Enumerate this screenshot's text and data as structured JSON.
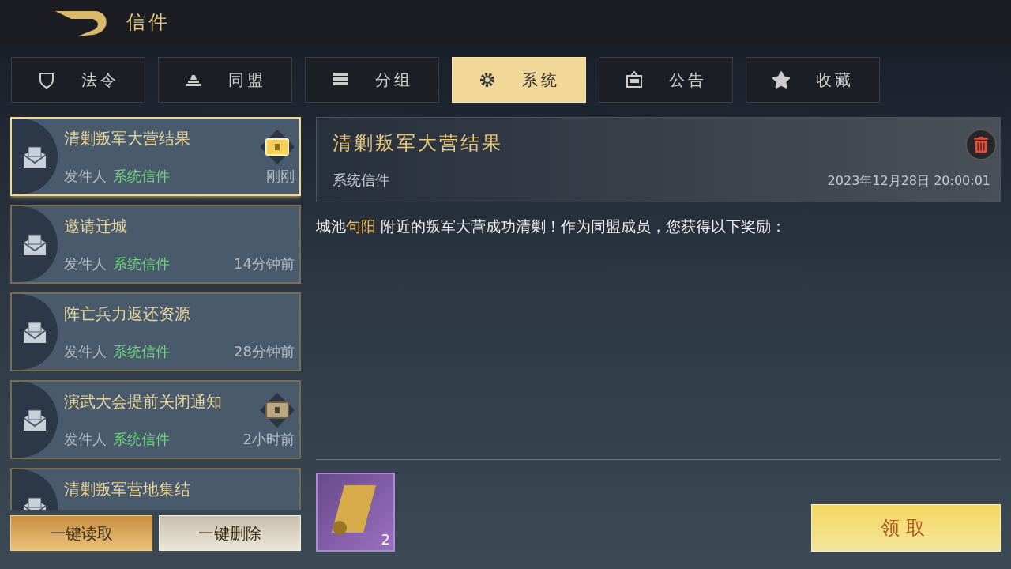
{
  "header": {
    "title": "信件"
  },
  "tabs": [
    {
      "label": "法令",
      "selected": false
    },
    {
      "label": "同盟",
      "selected": false
    },
    {
      "label": "分组",
      "selected": false
    },
    {
      "label": "系统",
      "selected": true
    },
    {
      "label": "公告",
      "selected": false
    },
    {
      "label": "收藏",
      "selected": false
    }
  ],
  "mails": [
    {
      "subject": "清剿叛军大营结果",
      "sender_label": "发件人",
      "sender": "系统信件",
      "time": "刚刚",
      "selected": true,
      "attachment": {
        "claimed": false
      }
    },
    {
      "subject": "邀请迁城",
      "sender_label": "发件人",
      "sender": "系统信件",
      "time": "14分钟前",
      "selected": false
    },
    {
      "subject": "阵亡兵力返还资源",
      "sender_label": "发件人",
      "sender": "系统信件",
      "time": "28分钟前",
      "selected": false
    },
    {
      "subject": "演武大会提前关闭通知",
      "sender_label": "发件人",
      "sender": "系统信件",
      "time": "2小时前",
      "selected": false,
      "attachment": {
        "claimed": true
      }
    },
    {
      "subject": "清剿叛军营地集结",
      "selected": false
    }
  ],
  "list_buttons": [
    {
      "label": "一键读取",
      "kind": "primary"
    },
    {
      "label": "一键删除",
      "kind": "secondary"
    }
  ],
  "detail": {
    "title": "清剿叛军大营结果",
    "sender": "系统信件",
    "datetime": "2023年12月28日 20:00:01",
    "body": [
      {
        "text": "城池",
        "kind": "plain"
      },
      {
        "text": "句阳",
        "kind": "place"
      },
      {
        "text": " 附近的叛军大营成功清剿！作为同盟成员，您获得以下奖励：",
        "kind": "plain"
      }
    ],
    "rewards": [
      {
        "count": "2"
      }
    ],
    "claim_button": "领取"
  }
}
